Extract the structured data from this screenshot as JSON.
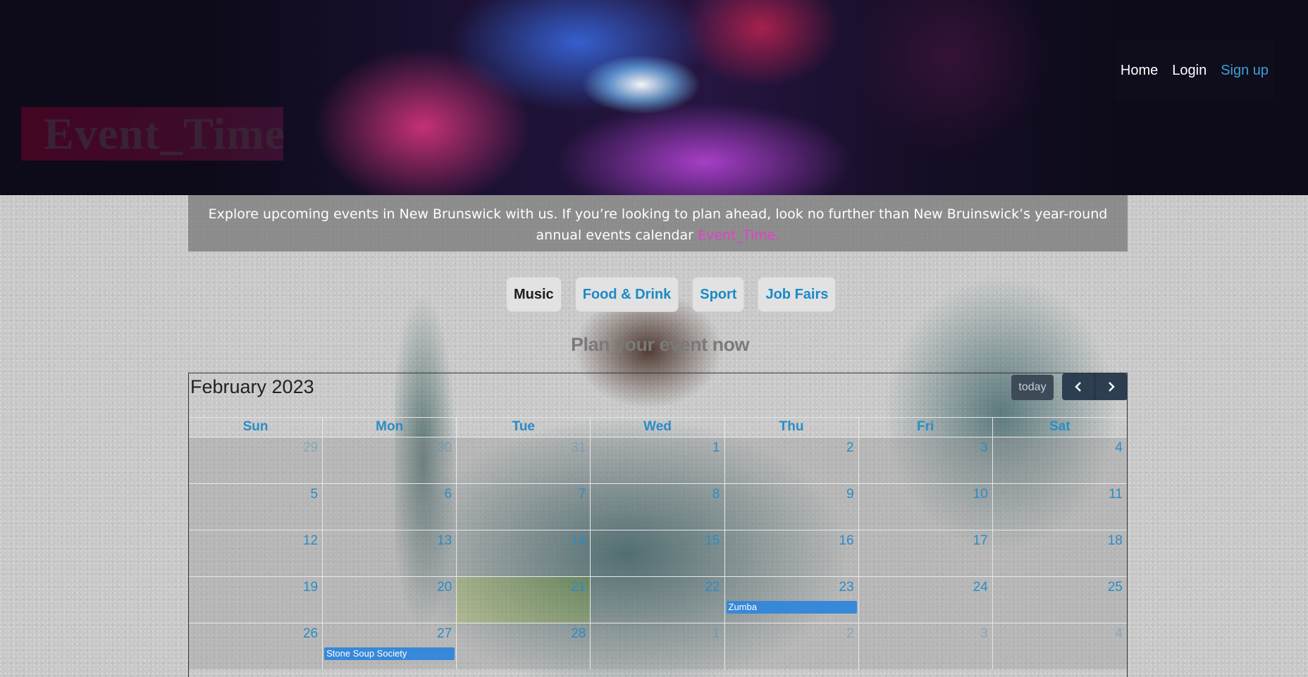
{
  "header": {
    "brand": "Event_Time",
    "nav": [
      {
        "label": "Home"
      },
      {
        "label": "Login"
      },
      {
        "label": "Sign up"
      }
    ]
  },
  "intro": {
    "text": "Explore upcoming events in New Brunswick with us. If you’re looking to plan ahead, look no further than New Bruinswick’s year-round annual events calendar ",
    "accent": "Event_Time."
  },
  "categories": [
    {
      "label": "Music",
      "active": true
    },
    {
      "label": "Food & Drink",
      "active": false
    },
    {
      "label": "Sport",
      "active": false
    },
    {
      "label": "Job Fairs",
      "active": false
    }
  ],
  "plan_heading": "Plan your event now",
  "calendar": {
    "title": "February 2023",
    "today_label": "today",
    "prev_icon": "chevron-left-icon",
    "next_icon": "chevron-right-icon",
    "weekdays": [
      "Sun",
      "Mon",
      "Tue",
      "Wed",
      "Thu",
      "Fri",
      "Sat"
    ],
    "weeks": [
      [
        {
          "d": "29",
          "other": true
        },
        {
          "d": "30",
          "other": true
        },
        {
          "d": "31",
          "other": true
        },
        {
          "d": "1"
        },
        {
          "d": "2"
        },
        {
          "d": "3"
        },
        {
          "d": "4"
        }
      ],
      [
        {
          "d": "5"
        },
        {
          "d": "6"
        },
        {
          "d": "7"
        },
        {
          "d": "8"
        },
        {
          "d": "9"
        },
        {
          "d": "10"
        },
        {
          "d": "11"
        }
      ],
      [
        {
          "d": "12"
        },
        {
          "d": "13"
        },
        {
          "d": "14"
        },
        {
          "d": "15"
        },
        {
          "d": "16"
        },
        {
          "d": "17"
        },
        {
          "d": "18"
        }
      ],
      [
        {
          "d": "19"
        },
        {
          "d": "20"
        },
        {
          "d": "21",
          "today": true
        },
        {
          "d": "22"
        },
        {
          "d": "23",
          "event": "Zumba"
        },
        {
          "d": "24"
        },
        {
          "d": "25"
        }
      ],
      [
        {
          "d": "26"
        },
        {
          "d": "27",
          "event": "Stone Soup Society"
        },
        {
          "d": "28"
        },
        {
          "d": "1",
          "other": true
        },
        {
          "d": "2",
          "other": true
        },
        {
          "d": "3",
          "other": true
        },
        {
          "d": "4",
          "other": true
        }
      ]
    ]
  }
}
